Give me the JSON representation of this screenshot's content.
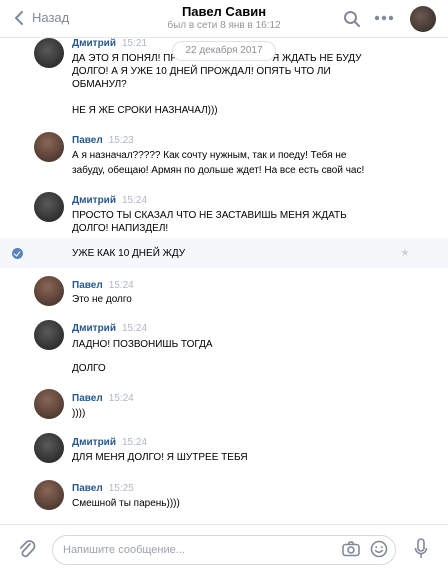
{
  "header": {
    "back_label": "Назад",
    "title": "Павел Савин",
    "subtitle": "был в сети 8 янв в 16:12"
  },
  "date_separator": "22 декабря 2017",
  "messages": [
    {
      "author": "Дмитрий",
      "time": "15:21",
      "lines": [
        "ДА ЭТО Я ПОНЯЛ! ПР",
        "Я ЖДАТЬ НЕ БУДУ",
        "ДОЛГО! А Я УЖЕ 10 ДНЕЙ ПРОЖДАЛ! ОПЯТЬ ЧТО ЛИ",
        "ОБМАНУЛ?",
        "НЕ Я ЖЕ СРОКИ НАЗНАЧАЛ)))"
      ]
    },
    {
      "author": "Павел",
      "time": "15:23",
      "lines": [
        "А я назначал????? Как сочту нужным, так и поеду! Тебя не",
        "забуду, обещаю! Армян по дольше ждет! На все есть свой час!"
      ]
    },
    {
      "author": "Дмитрий",
      "time": "15:24",
      "lines": [
        "ПРОСТО ТЫ СКАЗАЛ ЧТО НЕ ЗАСТАВИШЬ МЕНЯ ЖДАТЬ",
        "ДОЛГО! НАПИЗДЕЛ!",
        "УЖЕ КАК 10 ДНЕЙ ЖДУ"
      ]
    },
    {
      "author": "Павел",
      "time": "15:24",
      "lines": [
        "Это не долго"
      ]
    },
    {
      "author": "Дмитрий",
      "time": "15:24",
      "lines": [
        "ЛАДНО! ПОЗВОНИШЬ ТОГДА",
        "ДОЛГО"
      ]
    },
    {
      "author": "Павел",
      "time": "15:24",
      "lines": [
        "))))"
      ]
    },
    {
      "author": "Дмитрий",
      "time": "15:24",
      "lines": [
        "ДЛЯ МЕНЯ ДОЛГО! Я ШУТРЕЕ ТЕБЯ"
      ]
    },
    {
      "author": "Павел",
      "time": "15:25",
      "lines": [
        "Смешной ты парень))))"
      ]
    }
  ],
  "composer": {
    "placeholder": "Напишите сообщение..."
  },
  "icons": {
    "back": "chevron-left-icon",
    "search": "search-icon",
    "more": "more-dots-icon",
    "attach": "paperclip-icon",
    "camera": "camera-icon",
    "emoji": "smile-icon",
    "mic": "microphone-icon",
    "read": "check-icon",
    "star": "star-icon"
  },
  "colors": {
    "name": "#2a5885",
    "time": "#aeb7c2",
    "icon": "#828a99"
  }
}
